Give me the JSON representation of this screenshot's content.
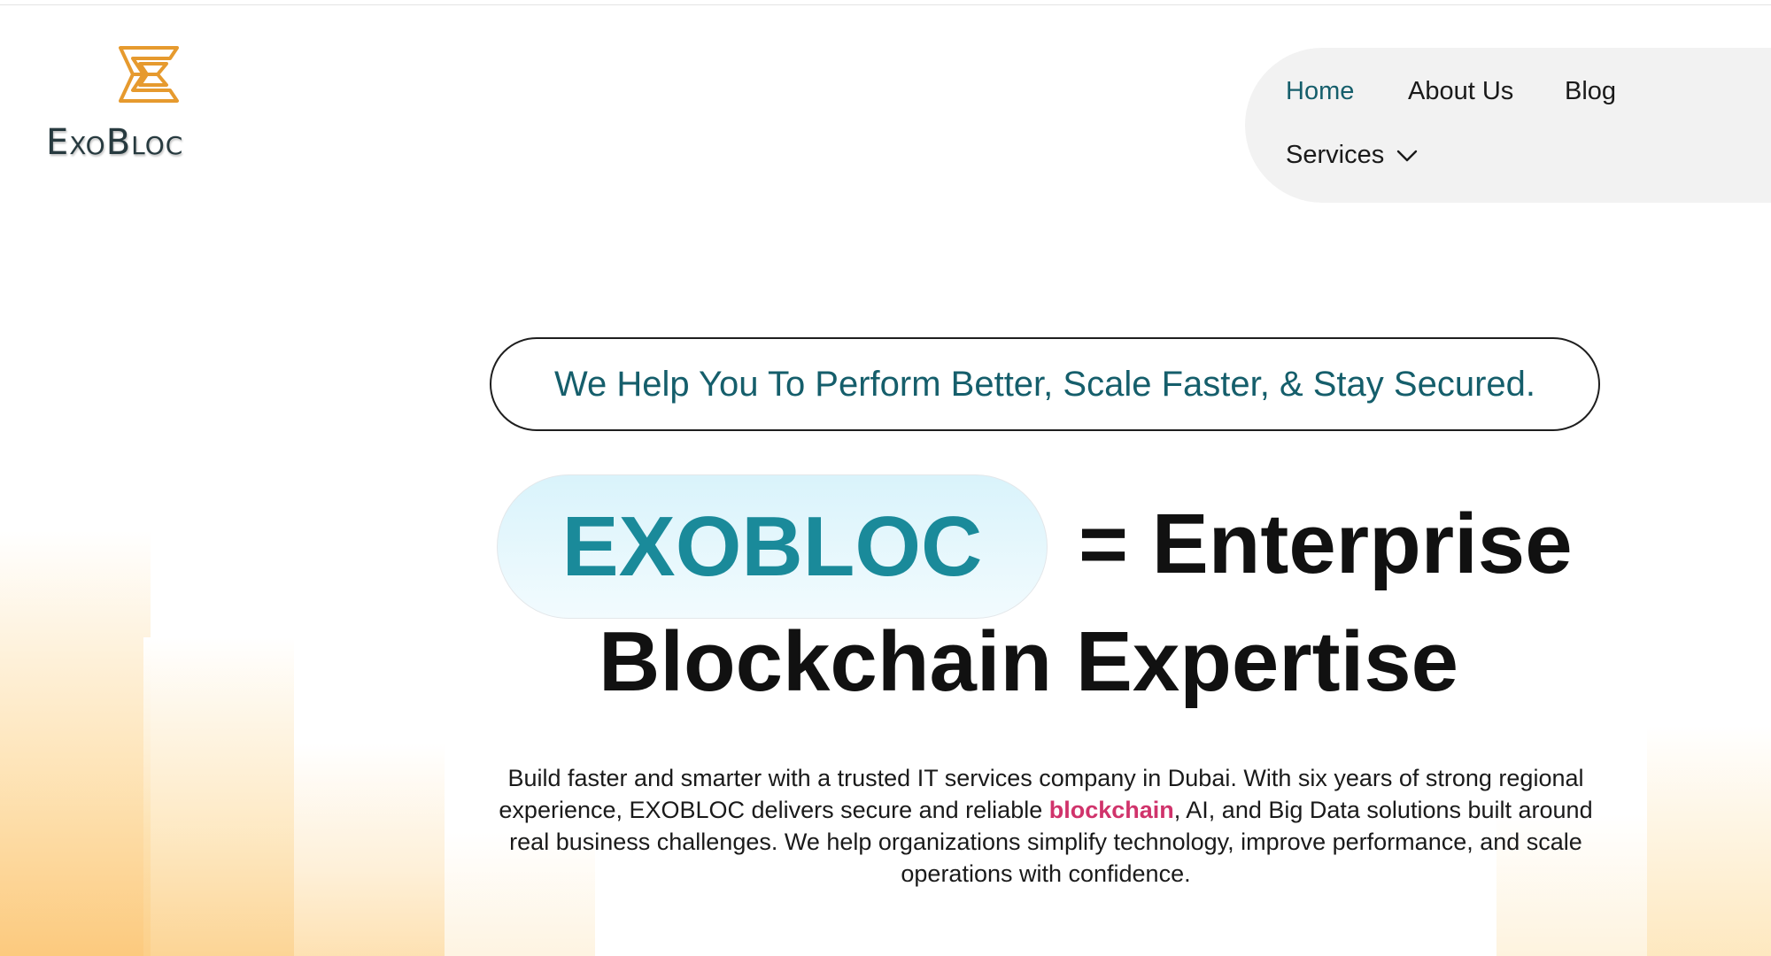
{
  "brand": {
    "name": "ExoBloc",
    "logo_color": "#e69a2e",
    "text_color": "#273a3f"
  },
  "nav": {
    "items": [
      {
        "label": "Home",
        "active": true
      },
      {
        "label": "About Us",
        "active": false
      },
      {
        "label": "Blog",
        "active": false
      },
      {
        "label": "Services",
        "active": false,
        "has_dropdown": true,
        "icon": "chevron-down-icon"
      }
    ],
    "active_color": "#155e6b"
  },
  "hero": {
    "tagline": "We Help You To Perform Better, Scale Faster, & Stay Secured.",
    "highlight_word": "EXOBLOC",
    "headline_rest_1": "= Enterprise",
    "headline_rest_2": "Blockchain Expertise",
    "desc_before": "Build faster and smarter with a trusted IT services company in Dubai. With six years of strong regional experience, EXOBLOC delivers secure and reliable ",
    "desc_link": "blockchain",
    "desc_after": ", AI, and Big Data solutions built around real business challenges. We help organizations simplify technology, improve performance, and scale operations with confidence.",
    "accent_teal": "#1a8a9a",
    "accent_pink": "#d0336b"
  }
}
